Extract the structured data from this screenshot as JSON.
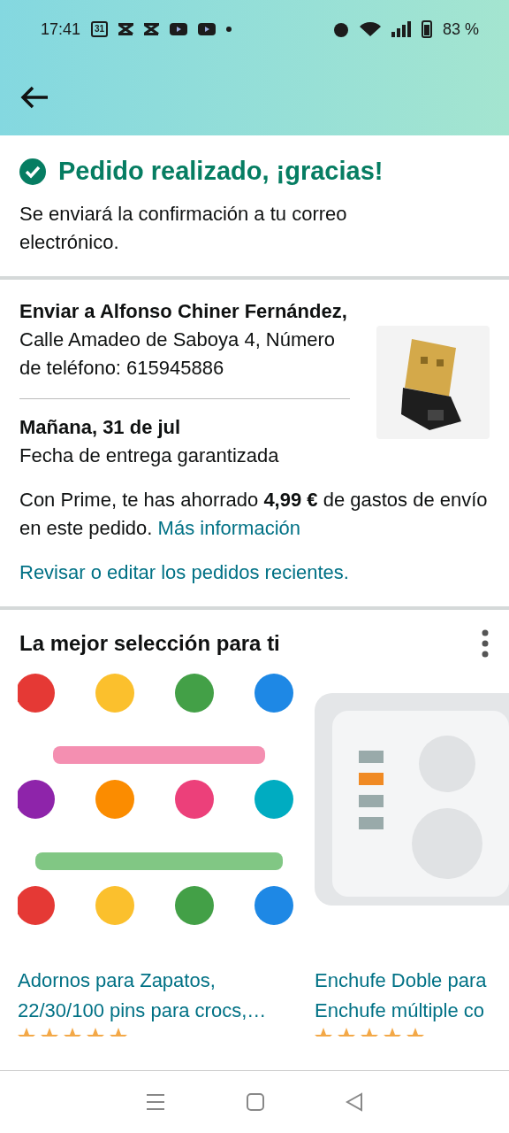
{
  "status_bar": {
    "time": "17:41",
    "calendar_day": "31",
    "battery": "83 %"
  },
  "confirmation": {
    "title": "Pedido realizado, ¡gracias!",
    "message": "Se enviará la confirmación a tu correo electrónico."
  },
  "shipping": {
    "address": "**Enviar a Alfonso Chiner Fernández,** Calle Amadeo de Saboya 4, Número de teléfono: 615945886",
    "delivery_date": "Mañana, 31 de jul",
    "delivery_note": "Fecha de entrega garantizada",
    "prime_note": "Con Prime, te has ahorrado **4,99 €** de gastos de envío en este pedido.",
    "prime_link": "Más información",
    "orders_link": "Revisar o editar los pedidos recientes."
  },
  "recommendations": {
    "title": "La mejor selección para ti",
    "products": [
      {
        "kind": "stickers",
        "title_lines": [
          "Adornos para Zapatos,",
          "22/30/100 pins para crocs,…"
        ]
      },
      {
        "kind": "socket",
        "title_lines": [
          "Enchufe Doble para",
          "Enchufe múltiple co"
        ]
      }
    ]
  }
}
